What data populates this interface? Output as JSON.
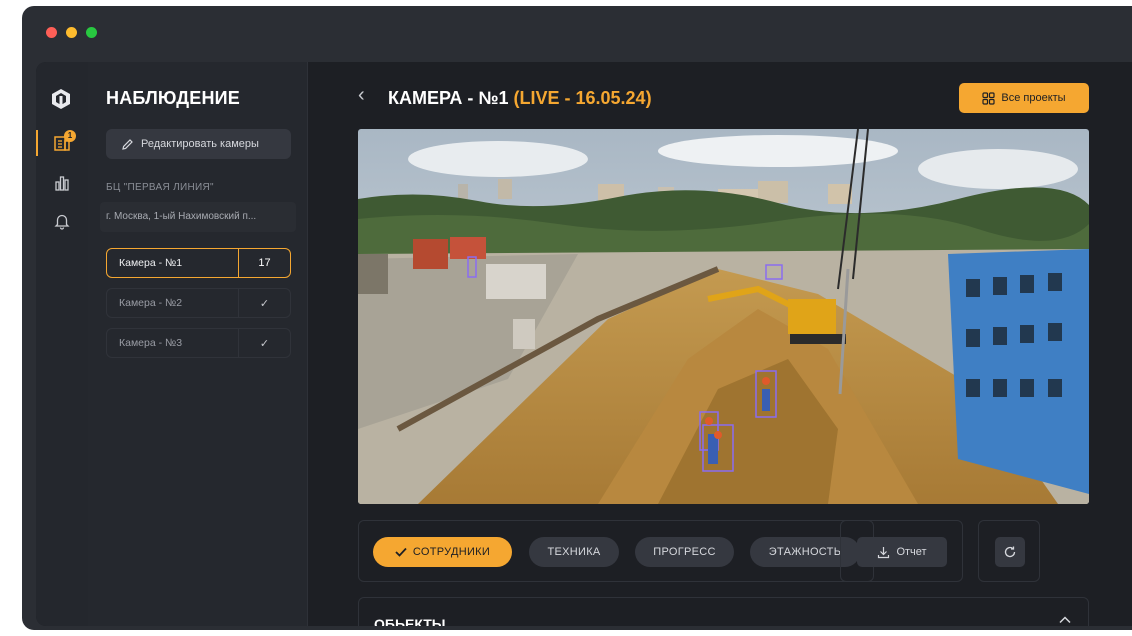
{
  "sidebar": {
    "title": "НАБЛЮДЕНИЕ",
    "edit_cameras_label": "Редактировать камеры",
    "project_name": "БЦ \"ПЕРВАЯ ЛИНИЯ\"",
    "address": "г. Москва, 1-ый Нахимовский п...",
    "cameras": [
      {
        "label": "Камера - №1",
        "status": "17",
        "active": true
      },
      {
        "label": "Камера - №2",
        "status": "✓",
        "active": false
      },
      {
        "label": "Камера - №3",
        "status": "✓",
        "active": false
      }
    ]
  },
  "rail": {
    "notification_count": "1"
  },
  "header": {
    "title": "КАМЕРА - №1",
    "live_label": "(LIVE - 16.05.24)",
    "all_projects_label": "Все проекты"
  },
  "filters": [
    {
      "label": "СОТРУДНИКИ",
      "active": true
    },
    {
      "label": "ТЕХНИКА",
      "active": false
    },
    {
      "label": "ПРОГРЕСС",
      "active": false
    },
    {
      "label": "ЭТАЖНОСТЬ",
      "active": false
    }
  ],
  "report_label": "Отчет",
  "objects_section": {
    "title": "ОБЬЕКТЫ"
  },
  "colors": {
    "accent": "#f5a731",
    "background": "#1d1f24",
    "panel": "#25282e",
    "detection_box": "#8a6cf0"
  },
  "icons": [
    "logo-icon",
    "buildings-icon",
    "chart-icon",
    "bell-icon",
    "pencil-icon",
    "back-chevron-icon",
    "grid-icon",
    "check-icon",
    "download-icon",
    "refresh-icon",
    "chevron-up-icon"
  ]
}
